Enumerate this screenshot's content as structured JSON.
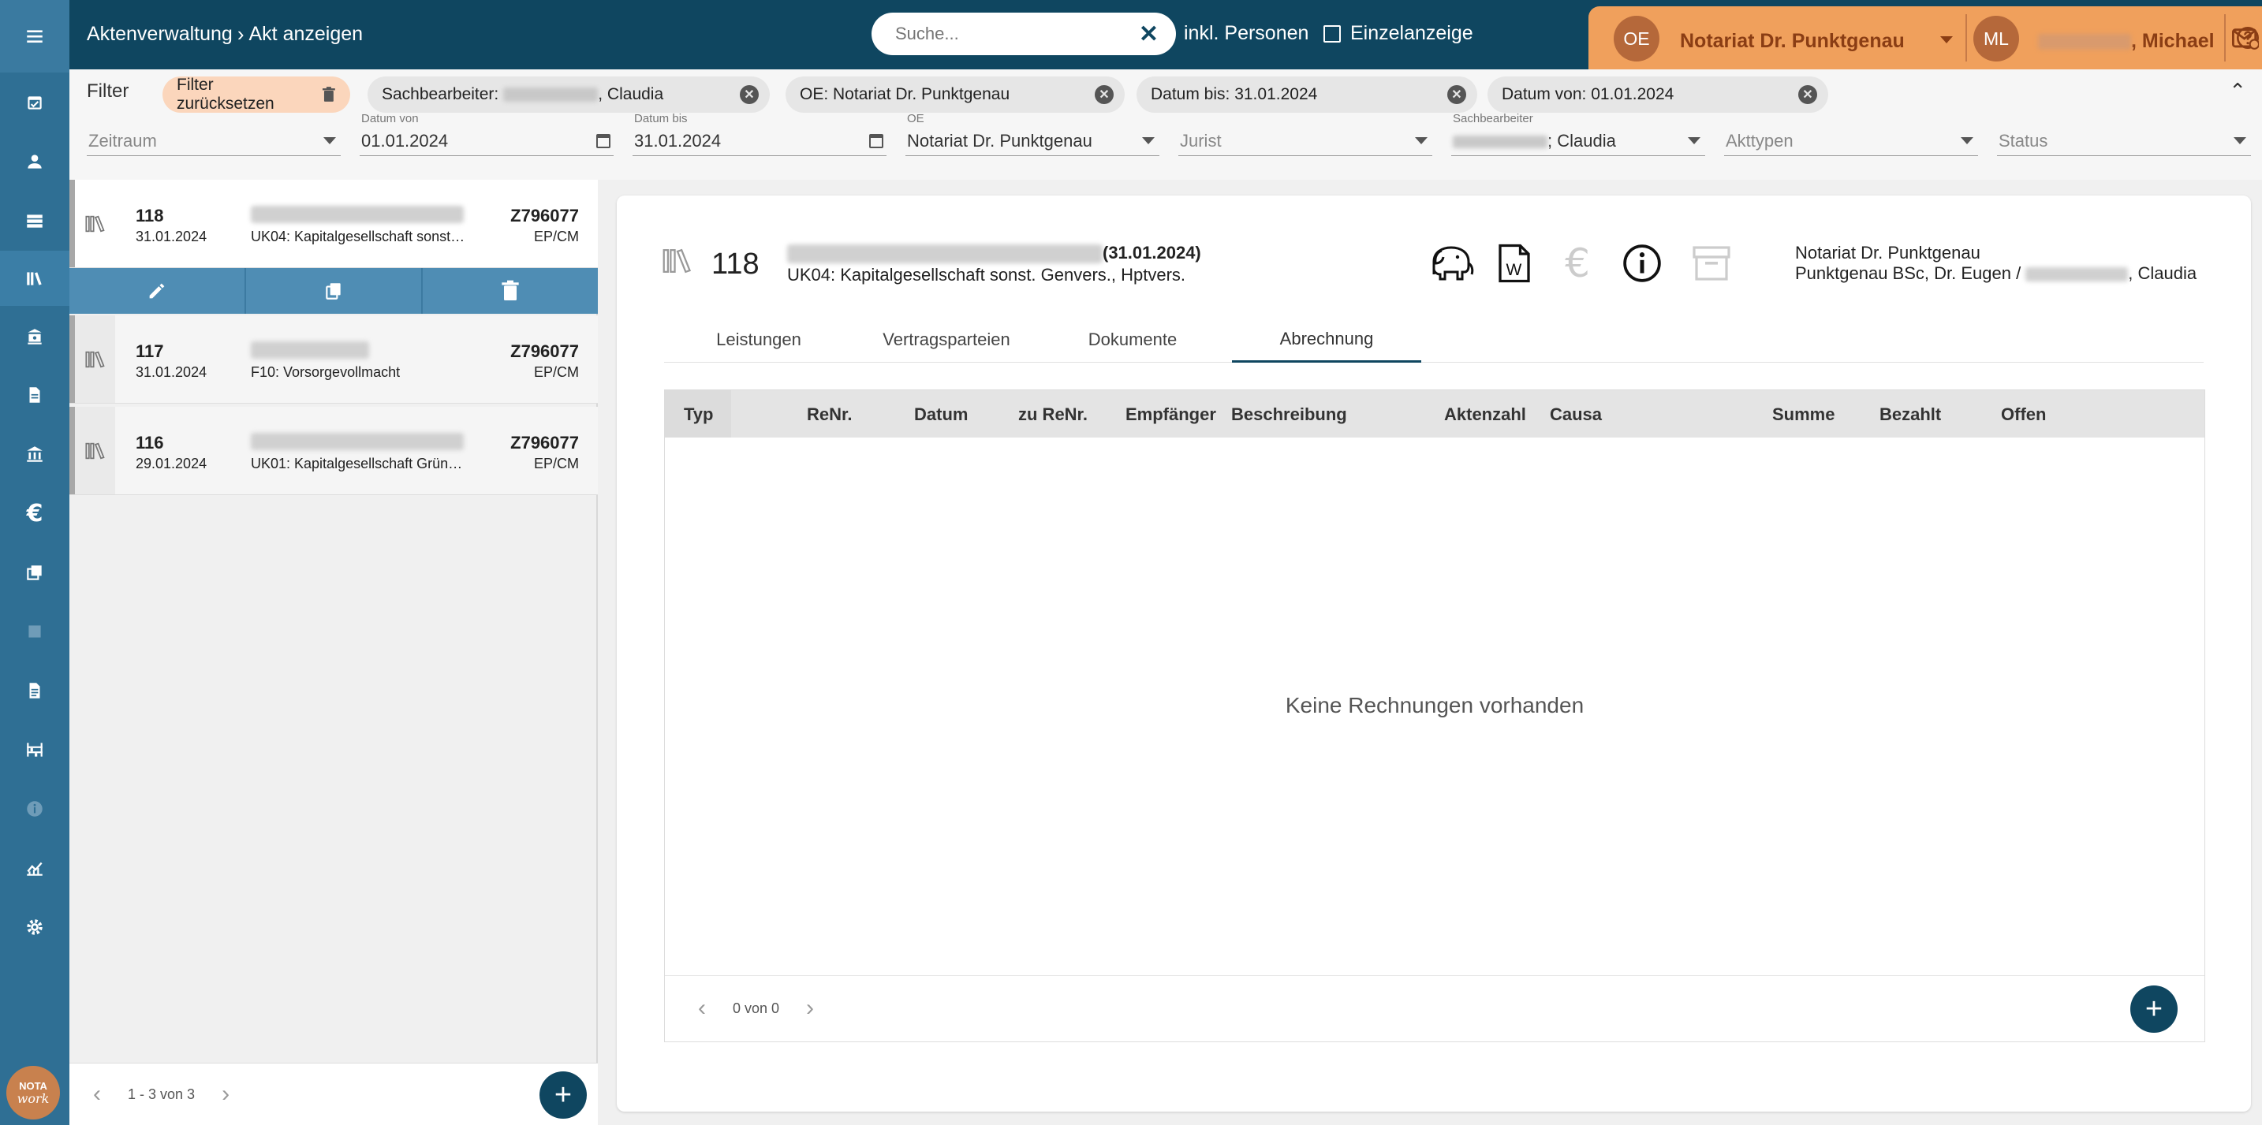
{
  "app": {
    "breadcrumb": [
      "Aktenverwaltung",
      "Akt anzeigen"
    ],
    "search_placeholder": "Suche...",
    "check_personen": "inkl. Personen",
    "check_einzel": "Einzelanzeige",
    "org_initials": "OE",
    "org_name": "Notariat Dr. Punktgenau",
    "user_initials": "ML",
    "user_name_suffix": ", Michael",
    "accent": "#0f4660",
    "rail_color": "#2f6f94",
    "org_color": "#f0a05c",
    "logo_top": "NOTA",
    "logo_bottom": "work"
  },
  "filter": {
    "label": "Filter",
    "reset": "Filter zurücksetzen",
    "chips": {
      "sachbearbeiter_prefix": "Sachbearbeiter:",
      "sachbearbeiter_suffix": ", Claudia",
      "oe": "OE: Notariat Dr. Punktgenau",
      "datum_bis": "Datum bis: 31.01.2024",
      "datum_von": "Datum von: 01.01.2024"
    },
    "fields": {
      "zeitraum": "Zeitraum",
      "datum_von_label": "Datum von",
      "datum_von": "01.01.2024",
      "datum_bis_label": "Datum bis",
      "datum_bis": "31.01.2024",
      "oe_label": "OE",
      "oe": "Notariat Dr. Punktgenau",
      "jurist": "Jurist",
      "sachbearbeiter_label": "Sachbearbeiter",
      "sachbearbeiter_suffix": "; Claudia",
      "akttypen": "Akttypen",
      "status": "Status"
    }
  },
  "list": {
    "items": [
      {
        "num": "118",
        "date": "31.01.2024",
        "desc": "UK04: Kapitalgesellschaft sonst…",
        "code": "Z796077",
        "init": "EP/CM"
      },
      {
        "num": "117",
        "date": "31.01.2024",
        "desc": "F10: Vorsorgevollmacht",
        "code": "Z796077",
        "init": "EP/CM"
      },
      {
        "num": "116",
        "date": "29.01.2024",
        "desc": "UK01: Kapitalgesellschaft Grün…",
        "code": "Z796077",
        "init": "EP/CM"
      }
    ],
    "pager": "1 - 3 von 3"
  },
  "detail": {
    "num": "118",
    "title_date": "(31.01.2024)",
    "subtitle": "UK04: Kapitalgesellschaft sonst. Genvers., Hptvers.",
    "org_line1": "Notariat Dr. Punktgenau",
    "org_line2_prefix": "Punktgenau BSc, Dr. Eugen / ",
    "org_line2_suffix": ", Claudia",
    "tabs": [
      "Leistungen",
      "Vertragsparteien",
      "Dokumente",
      "Abrechnung"
    ],
    "columns": [
      "Typ",
      "ReNr.",
      "Datum",
      "zu ReNr.",
      "Empfänger",
      "Beschreibung",
      "Aktenzahl",
      "Causa",
      "Summe",
      "Bezahlt",
      "Offen"
    ],
    "empty": "Keine Rechnungen vorhanden",
    "pager": "0 von 0"
  }
}
